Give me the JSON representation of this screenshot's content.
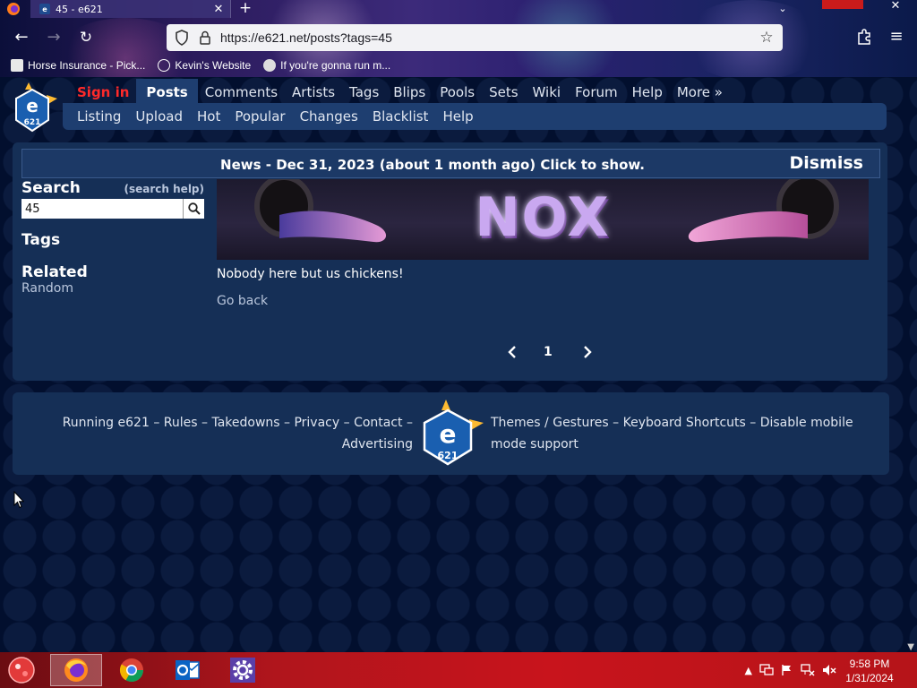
{
  "browser": {
    "tab_title": "45 - e621",
    "url": "https://e621.net/posts?tags=45",
    "bookmarks": [
      {
        "label": "Horse Insurance - Pick..."
      },
      {
        "label": "Kevin's Website"
      },
      {
        "label": "If you're gonna run m..."
      }
    ]
  },
  "site": {
    "logo_text": "e",
    "logo_sub": "621",
    "top_nav": [
      {
        "label": "Sign in"
      },
      {
        "label": "Posts"
      },
      {
        "label": "Comments"
      },
      {
        "label": "Artists"
      },
      {
        "label": "Tags"
      },
      {
        "label": "Blips"
      },
      {
        "label": "Pools"
      },
      {
        "label": "Sets"
      },
      {
        "label": "Wiki"
      },
      {
        "label": "Forum"
      },
      {
        "label": "Help"
      },
      {
        "label": "More »"
      }
    ],
    "sub_nav": [
      {
        "label": "Listing"
      },
      {
        "label": "Upload"
      },
      {
        "label": "Hot"
      },
      {
        "label": "Popular"
      },
      {
        "label": "Changes"
      },
      {
        "label": "Blacklist"
      },
      {
        "label": "Help"
      }
    ],
    "news": {
      "text": "News - Dec 31, 2023 (about 1 month ago) Click to show.",
      "dismiss": "Dismiss"
    },
    "sidebar": {
      "search_title": "Search",
      "search_help": "(search help)",
      "search_value": "45",
      "tags_title": "Tags",
      "related_title": "Related",
      "random_link": "Random"
    },
    "banner_text": "NOX",
    "empty_message": "Nobody here but us chickens!",
    "go_back": "Go back",
    "pager": {
      "current": "1"
    },
    "footer": {
      "running": "Running e621",
      "rules": "Rules",
      "takedowns": "Takedowns",
      "privacy": "Privacy",
      "contact": "Contact",
      "advertising": "Advertising",
      "themes": "Themes",
      "gestures": "Gestures",
      "shortcuts": "Keyboard Shortcuts",
      "disable_mobile": "Disable mobile mode support"
    }
  },
  "taskbar": {
    "time": "9:58 PM",
    "date": "1/31/2024",
    "apps": [
      {
        "icon": "firefox-icon",
        "active": true
      },
      {
        "icon": "chrome-icon",
        "active": false
      },
      {
        "icon": "outlook-icon",
        "active": false
      },
      {
        "icon": "settings-gear-icon",
        "active": false
      }
    ]
  },
  "colors": {
    "page_bg": "#020f2e",
    "panel_bg": "#152f56",
    "nav_active": "#1e3e70",
    "signin": "#ff2a2a",
    "link": "#b9c6dc",
    "taskbar": "#c8141c"
  }
}
